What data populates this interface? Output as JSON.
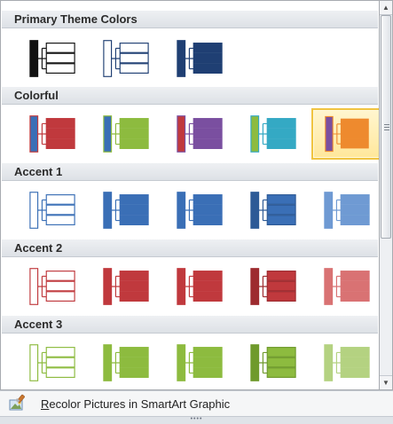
{
  "sections": [
    {
      "title": "Primary Theme Colors",
      "styles": [
        {
          "outline": "#111111",
          "fill": "#ffffff",
          "line": "#111111",
          "bar": "#111111"
        },
        {
          "outline": "#1f3f73",
          "fill": "#ffffff",
          "line": "#1f3f73",
          "bar": "#ffffff"
        },
        {
          "outline": "#1f3f73",
          "fill": "#1f3f73",
          "line": "#1f3f73",
          "bar": "#1f3f73"
        }
      ]
    },
    {
      "title": "Colorful",
      "styles": [
        {
          "outline": "#c0393d",
          "fill": "#c0393d",
          "line": "#c0393d",
          "bar": "#3a6fb6"
        },
        {
          "outline": "#8dbb3f",
          "fill": "#8dbb3f",
          "line": "#8dbb3f",
          "bar": "#3a6fb6"
        },
        {
          "outline": "#7a4fa0",
          "fill": "#7a4fa0",
          "line": "#7a4fa0",
          "bar": "#c0393d"
        },
        {
          "outline": "#34a9c4",
          "fill": "#34a9c4",
          "line": "#34a9c4",
          "bar": "#8dbb3f"
        },
        {
          "outline": "#ee8a2e",
          "fill": "#ee8a2e",
          "line": "#ee8a2e",
          "bar": "#7a4fa0",
          "selected": true
        }
      ]
    },
    {
      "title": "Accent 1",
      "styles": [
        {
          "outline": "#3a6fb6",
          "fill": "#ffffff",
          "line": "#3a6fb6",
          "bar": "#ffffff"
        },
        {
          "outline": "#3a6fb6",
          "fill": "#3a6fb6",
          "line": "#3a6fb6",
          "bar": "#3a6fb6"
        },
        {
          "outline": "#3a6fb6",
          "fill": "#3a6fb6",
          "line": "#3a6fb6",
          "bar": "#3a6fb6"
        },
        {
          "outline": "#2d5a96",
          "fill": "#3a6fb6",
          "line": "#2d5a96",
          "bar": "#2d5a96"
        },
        {
          "outline": "#6f9ad3",
          "fill": "#6f9ad3",
          "line": "#6f9ad3",
          "bar": "#6f9ad3"
        }
      ]
    },
    {
      "title": "Accent 2",
      "styles": [
        {
          "outline": "#c0393d",
          "fill": "#ffffff",
          "line": "#c0393d",
          "bar": "#ffffff"
        },
        {
          "outline": "#c0393d",
          "fill": "#c0393d",
          "line": "#c0393d",
          "bar": "#c0393d"
        },
        {
          "outline": "#c0393d",
          "fill": "#c0393d",
          "line": "#c0393d",
          "bar": "#c0393d"
        },
        {
          "outline": "#9d2b2f",
          "fill": "#c0393d",
          "line": "#9d2b2f",
          "bar": "#9d2b2f"
        },
        {
          "outline": "#d97273",
          "fill": "#d97273",
          "line": "#d97273",
          "bar": "#d97273"
        }
      ]
    },
    {
      "title": "Accent 3",
      "styles": [
        {
          "outline": "#8dbb3f",
          "fill": "#ffffff",
          "line": "#8dbb3f",
          "bar": "#ffffff"
        },
        {
          "outline": "#8dbb3f",
          "fill": "#8dbb3f",
          "line": "#8dbb3f",
          "bar": "#8dbb3f"
        },
        {
          "outline": "#8dbb3f",
          "fill": "#8dbb3f",
          "line": "#8dbb3f",
          "bar": "#8dbb3f"
        },
        {
          "outline": "#6f9a2c",
          "fill": "#8dbb3f",
          "line": "#6f9a2c",
          "bar": "#6f9a2c"
        },
        {
          "outline": "#b4d281",
          "fill": "#b4d281",
          "line": "#b4d281",
          "bar": "#b4d281"
        }
      ]
    }
  ],
  "footer": {
    "recolor_mnemonic": "R",
    "recolor_rest": "ecolor Pictures in SmartArt Graphic",
    "recolor_icon": "recolor-pictures-icon",
    "grip_glyph": "••••"
  }
}
